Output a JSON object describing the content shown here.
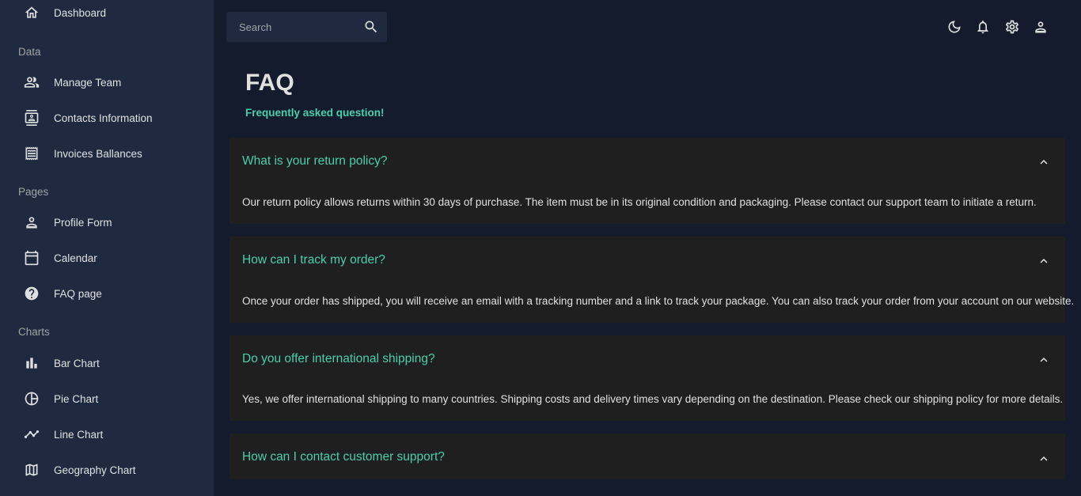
{
  "sidebar": {
    "dashboard": "Dashboard",
    "sections": {
      "data": "Data",
      "pages": "Pages",
      "charts": "Charts"
    },
    "items": {
      "manage_team": "Manage Team",
      "contacts": "Contacts Information",
      "invoices": "Invoices Ballances",
      "profile_form": "Profile Form",
      "calendar": "Calendar",
      "faq": "FAQ page",
      "bar_chart": "Bar Chart",
      "pie_chart": "Pie Chart",
      "line_chart": "Line Chart",
      "geography_chart": "Geography Chart"
    }
  },
  "topbar": {
    "search_placeholder": "Search",
    "icons": [
      "moon-icon",
      "bell-icon",
      "gear-icon",
      "person-icon"
    ]
  },
  "header": {
    "title": "FAQ",
    "subtitle": "Frequently asked question!"
  },
  "faqs": [
    {
      "question": "What is your return policy?",
      "answer": "Our return policy allows returns within 30 days of purchase. The item must be in its original condition and packaging. Please contact our support team to initiate a return."
    },
    {
      "question": "How can I track my order?",
      "answer": "Once your order has shipped, you will receive an email with a tracking number and a link to track your package. You can also track your order from your account on our website."
    },
    {
      "question": "Do you offer international shipping?",
      "answer": "Yes, we offer international shipping to many countries. Shipping costs and delivery times vary depending on the destination. Please check our shipping policy for more details."
    },
    {
      "question": "How can I contact customer support?",
      "answer": ""
    }
  ],
  "colors": {
    "background": "#141b2d",
    "sidebar": "#1f2a40",
    "accent": "#4cceac",
    "card": "#1f1f1f"
  }
}
